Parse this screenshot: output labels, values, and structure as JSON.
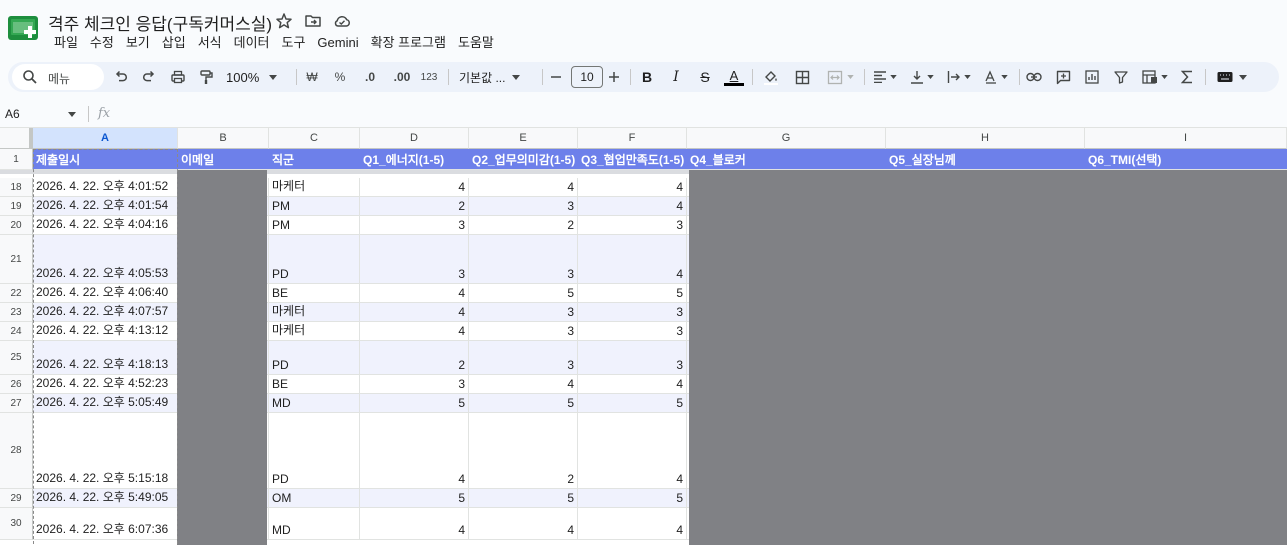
{
  "app": {
    "doc_title": "격주 체크인 응답(구독커머스실)",
    "menu": [
      "파일",
      "수정",
      "보기",
      "삽입",
      "서식",
      "데이터",
      "도구",
      "Gemini",
      "확장 프로그램",
      "도움말"
    ]
  },
  "toolbar": {
    "search_label": "메뉴",
    "zoom": "100%",
    "currency": "₩",
    "percent": "%",
    "dec_decrease": ".0",
    "dec_increase": ".00",
    "number_format": "123",
    "font": "기본값 ...",
    "font_size": "10",
    "text_color_letter": "A"
  },
  "formula_bar": {
    "cell_ref": "A6",
    "fx": "fx"
  },
  "grid": {
    "columns": [
      {
        "letter": "A",
        "selected": true
      },
      {
        "letter": "B",
        "selected": false
      },
      {
        "letter": "C",
        "selected": false
      },
      {
        "letter": "D",
        "selected": false
      },
      {
        "letter": "E",
        "selected": false
      },
      {
        "letter": "F",
        "selected": false
      },
      {
        "letter": "G",
        "selected": false
      },
      {
        "letter": "H",
        "selected": false
      },
      {
        "letter": "I",
        "selected": false
      }
    ],
    "header_row_number": "1",
    "headers": [
      "제출일시",
      "이메일",
      "직군",
      "Q1_에너지(1-5)",
      "Q2_업무의미감(1-5)",
      "Q3_협업만족도(1-5)",
      "Q4_블로커",
      "Q5_실장님께",
      "Q6_TMI(선택)"
    ],
    "rows": [
      {
        "num": "18",
        "timestamp": "2026. 4. 22. 오후 4:01:52",
        "role": "마케터",
        "q1": "4",
        "q2": "4",
        "q3": "4",
        "tall": "s",
        "shaded": false
      },
      {
        "num": "19",
        "timestamp": "2026. 4. 22. 오후 4:01:54",
        "role": "PM",
        "q1": "2",
        "q2": "3",
        "q3": "4",
        "tall": "s",
        "shaded": true
      },
      {
        "num": "20",
        "timestamp": "2026. 4. 22. 오후 4:04:16",
        "role": "PM",
        "q1": "3",
        "q2": "2",
        "q3": "3",
        "tall": "s",
        "shaded": false
      },
      {
        "num": "21",
        "timestamp": "2026. 4. 22. 오후 4:05:53",
        "role": "PD",
        "q1": "3",
        "q2": "3",
        "q3": "4",
        "tall": "m",
        "shaded": true
      },
      {
        "num": "22",
        "timestamp": "2026. 4. 22. 오후 4:06:40",
        "role": "BE",
        "q1": "4",
        "q2": "5",
        "q3": "5",
        "tall": "s",
        "shaded": false
      },
      {
        "num": "23",
        "timestamp": "2026. 4. 22. 오후 4:07:57",
        "role": "마케터",
        "q1": "4",
        "q2": "3",
        "q3": "3",
        "tall": "s",
        "shaded": true
      },
      {
        "num": "24",
        "timestamp": "2026. 4. 22. 오후 4:13:12",
        "role": "마케터",
        "q1": "4",
        "q2": "3",
        "q3": "3",
        "tall": "s",
        "shaded": false
      },
      {
        "num": "25",
        "timestamp": "2026. 4. 22. 오후 4:18:13",
        "role": "PD",
        "q1": "2",
        "q2": "3",
        "q3": "3",
        "tall": "m2",
        "shaded": true
      },
      {
        "num": "26",
        "timestamp": "2026. 4. 22. 오후 4:52:23",
        "role": "BE",
        "q1": "3",
        "q2": "4",
        "q3": "4",
        "tall": "s",
        "shaded": false
      },
      {
        "num": "27",
        "timestamp": "2026. 4. 22. 오후 5:05:49",
        "role": "MD",
        "q1": "5",
        "q2": "5",
        "q3": "5",
        "tall": "s",
        "shaded": true
      },
      {
        "num": "28",
        "timestamp": "2026. 4. 22. 오후 5:15:18",
        "role": "PD",
        "q1": "4",
        "q2": "2",
        "q3": "4",
        "tall": "l",
        "shaded": false
      },
      {
        "num": "29",
        "timestamp": "2026. 4. 22. 오후 5:49:05",
        "role": "OM",
        "q1": "5",
        "q2": "5",
        "q3": "5",
        "tall": "s",
        "shaded": true
      },
      {
        "num": "30",
        "timestamp": "2026. 4. 22. 오후 6:07:36",
        "role": "MD",
        "q1": "4",
        "q2": "4",
        "q3": "4",
        "tall": "m3",
        "shaded": false
      }
    ]
  },
  "colors": {
    "header_fill": "#6d80ea",
    "band_fill": "#f0f2fd",
    "redaction": "#808185",
    "selected_col": "#d3e3fd"
  }
}
